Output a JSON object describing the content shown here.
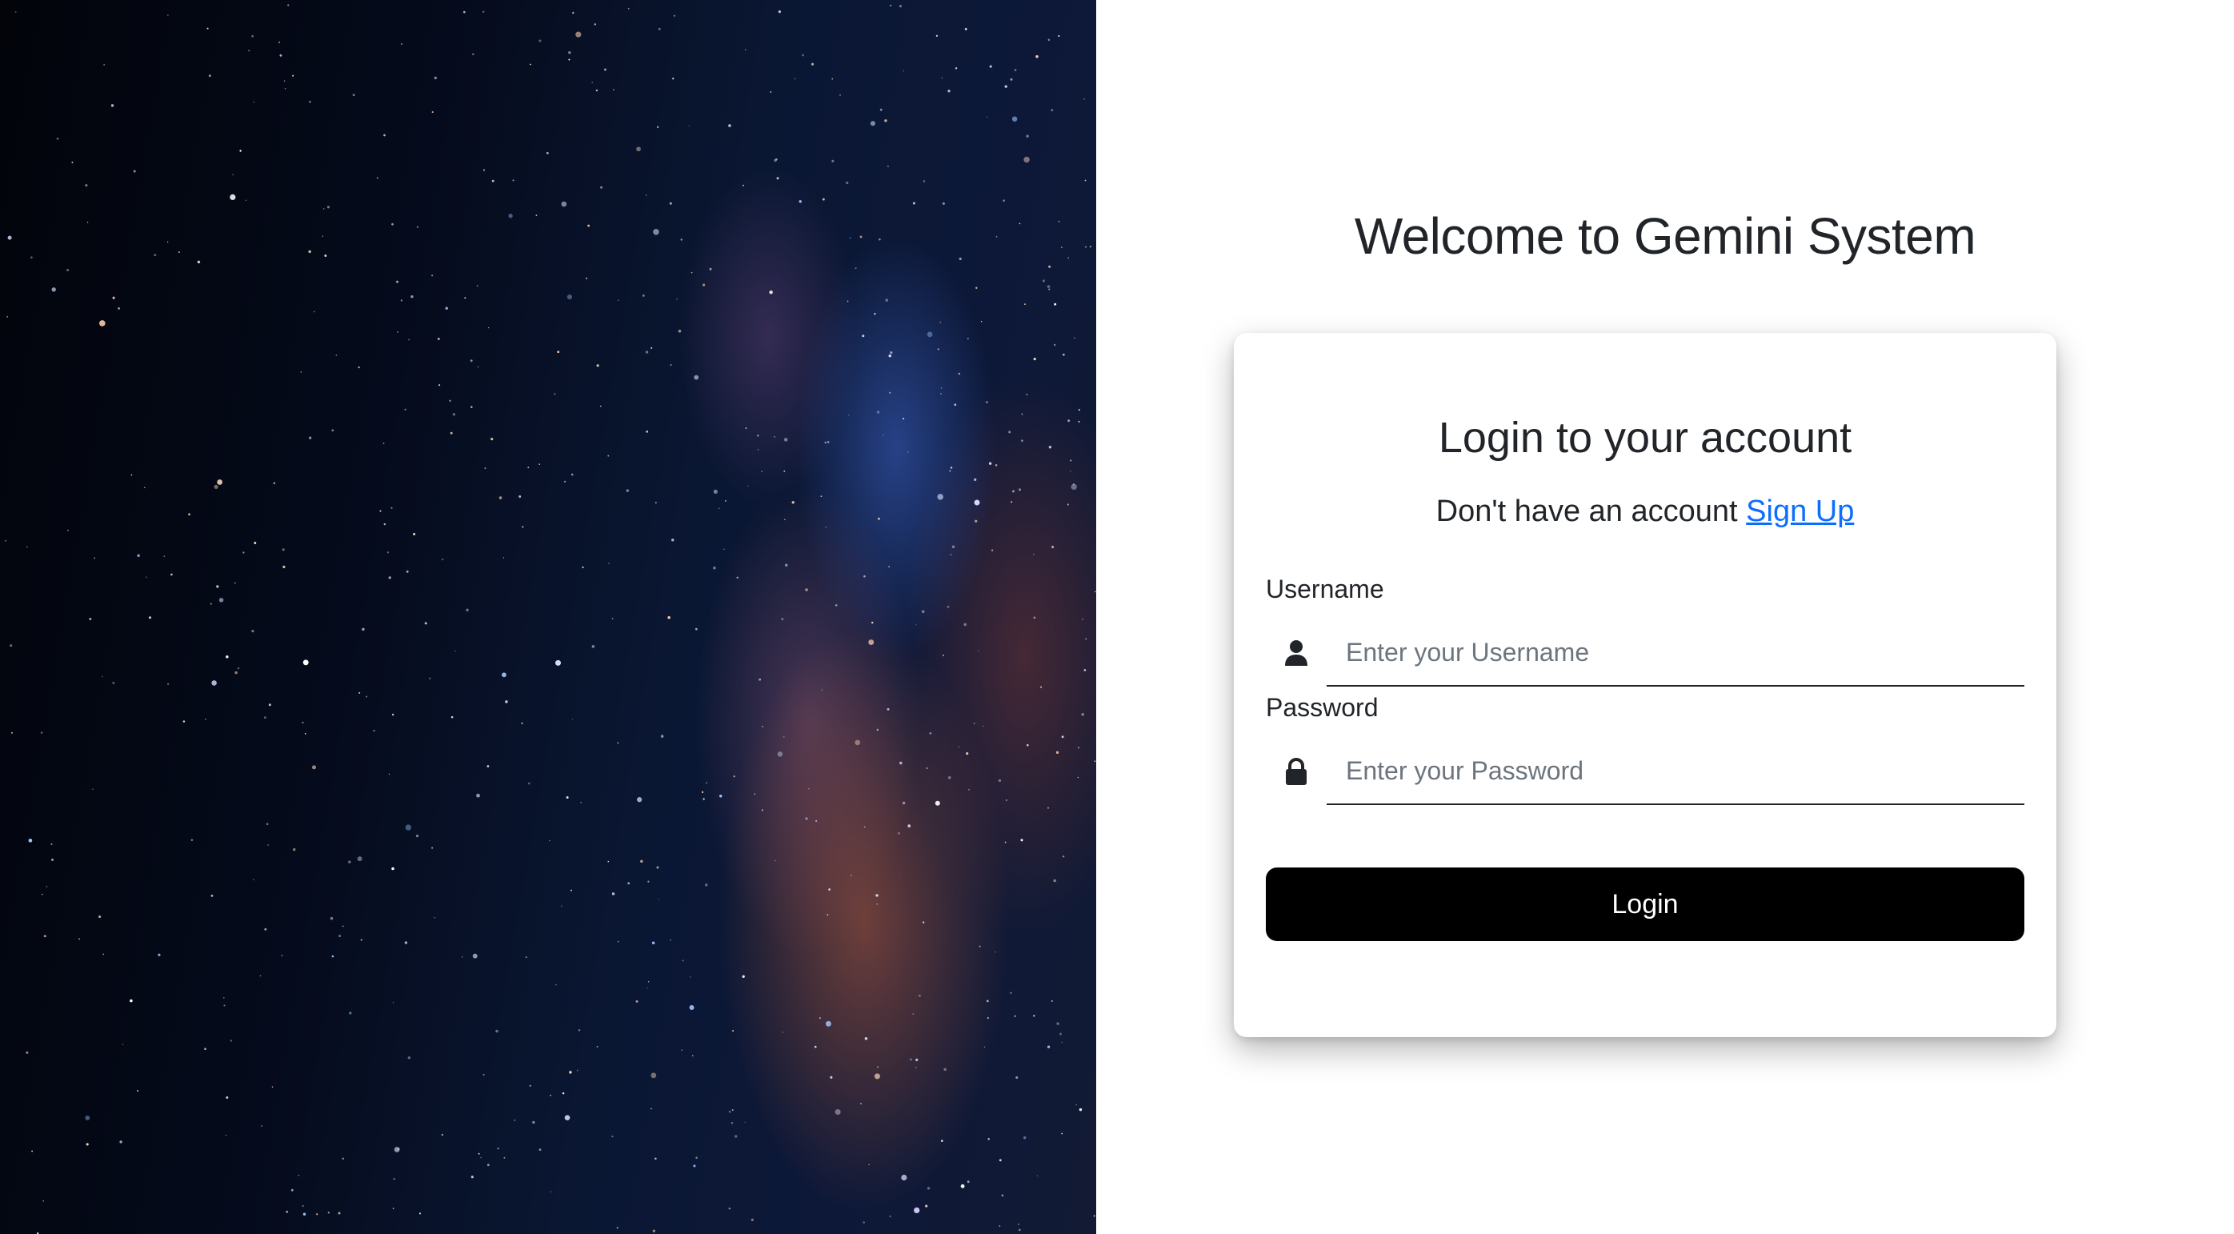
{
  "header": {
    "title": "Welcome to Gemini System"
  },
  "login_card": {
    "title": "Login to your account",
    "signup_prompt": "Don't have an account",
    "signup_link": "Sign Up",
    "username": {
      "label": "Username",
      "placeholder": "Enter your Username",
      "value": "",
      "icon": "user-icon"
    },
    "password": {
      "label": "Password",
      "placeholder": "Enter your Password",
      "value": "",
      "icon": "lock-icon"
    },
    "submit_label": "Login"
  },
  "theme": {
    "link_color": "#0d6efd",
    "button_color": "#000000",
    "text_color": "#212529"
  },
  "hero_image": {
    "subject": "starry-night-sky-milky-way"
  }
}
